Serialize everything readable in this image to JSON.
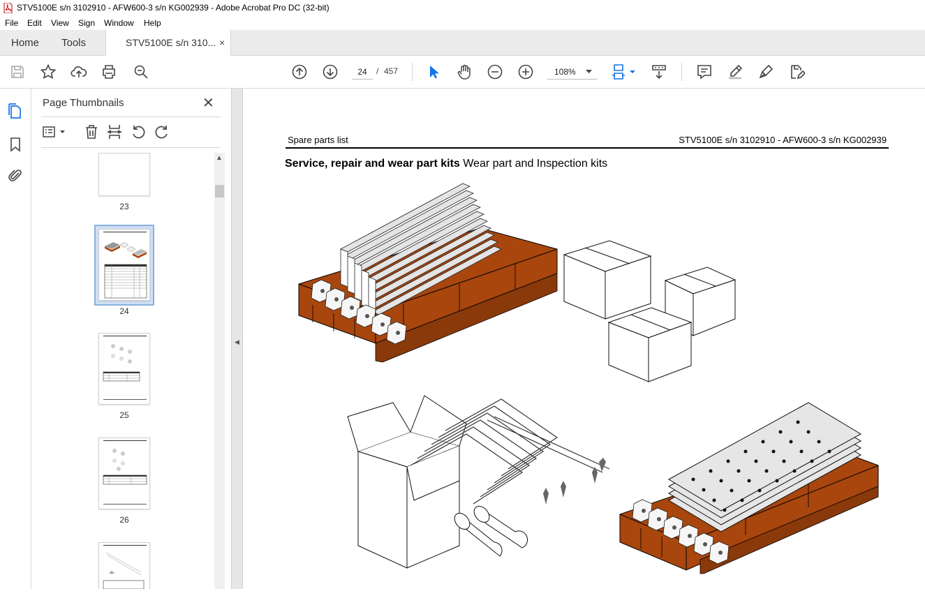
{
  "window": {
    "title": "STV5100E s/n 3102910 - AFW600-3 s/n KG002939 - Adobe Acrobat Pro DC (32-bit)"
  },
  "menu": [
    "File",
    "Edit",
    "View",
    "Sign",
    "Window",
    "Help"
  ],
  "tabs": {
    "home": "Home",
    "tools": "Tools",
    "document": "STV5100E s/n 310...",
    "close": "×"
  },
  "toolbar": {
    "current_page": "24",
    "page_sep": "/",
    "total_pages": "457",
    "zoom": "108%"
  },
  "panel": {
    "title": "Page Thumbnails",
    "close": "✕",
    "thumbnails": [
      {
        "label": "23"
      },
      {
        "label": "24"
      },
      {
        "label": "25"
      },
      {
        "label": "26"
      }
    ]
  },
  "document": {
    "header_left": "Spare parts list",
    "header_right": "STV5100E s/n 3102910 - AFW600-3 s/n KG002939",
    "subtitle_bold": "Service, repair and wear part kits",
    "subtitle_rest": " Wear part and Inspection kits"
  },
  "colors": {
    "accent": "#1473e6",
    "pallet": "#a8460e",
    "selection": "#cfe0f4"
  }
}
